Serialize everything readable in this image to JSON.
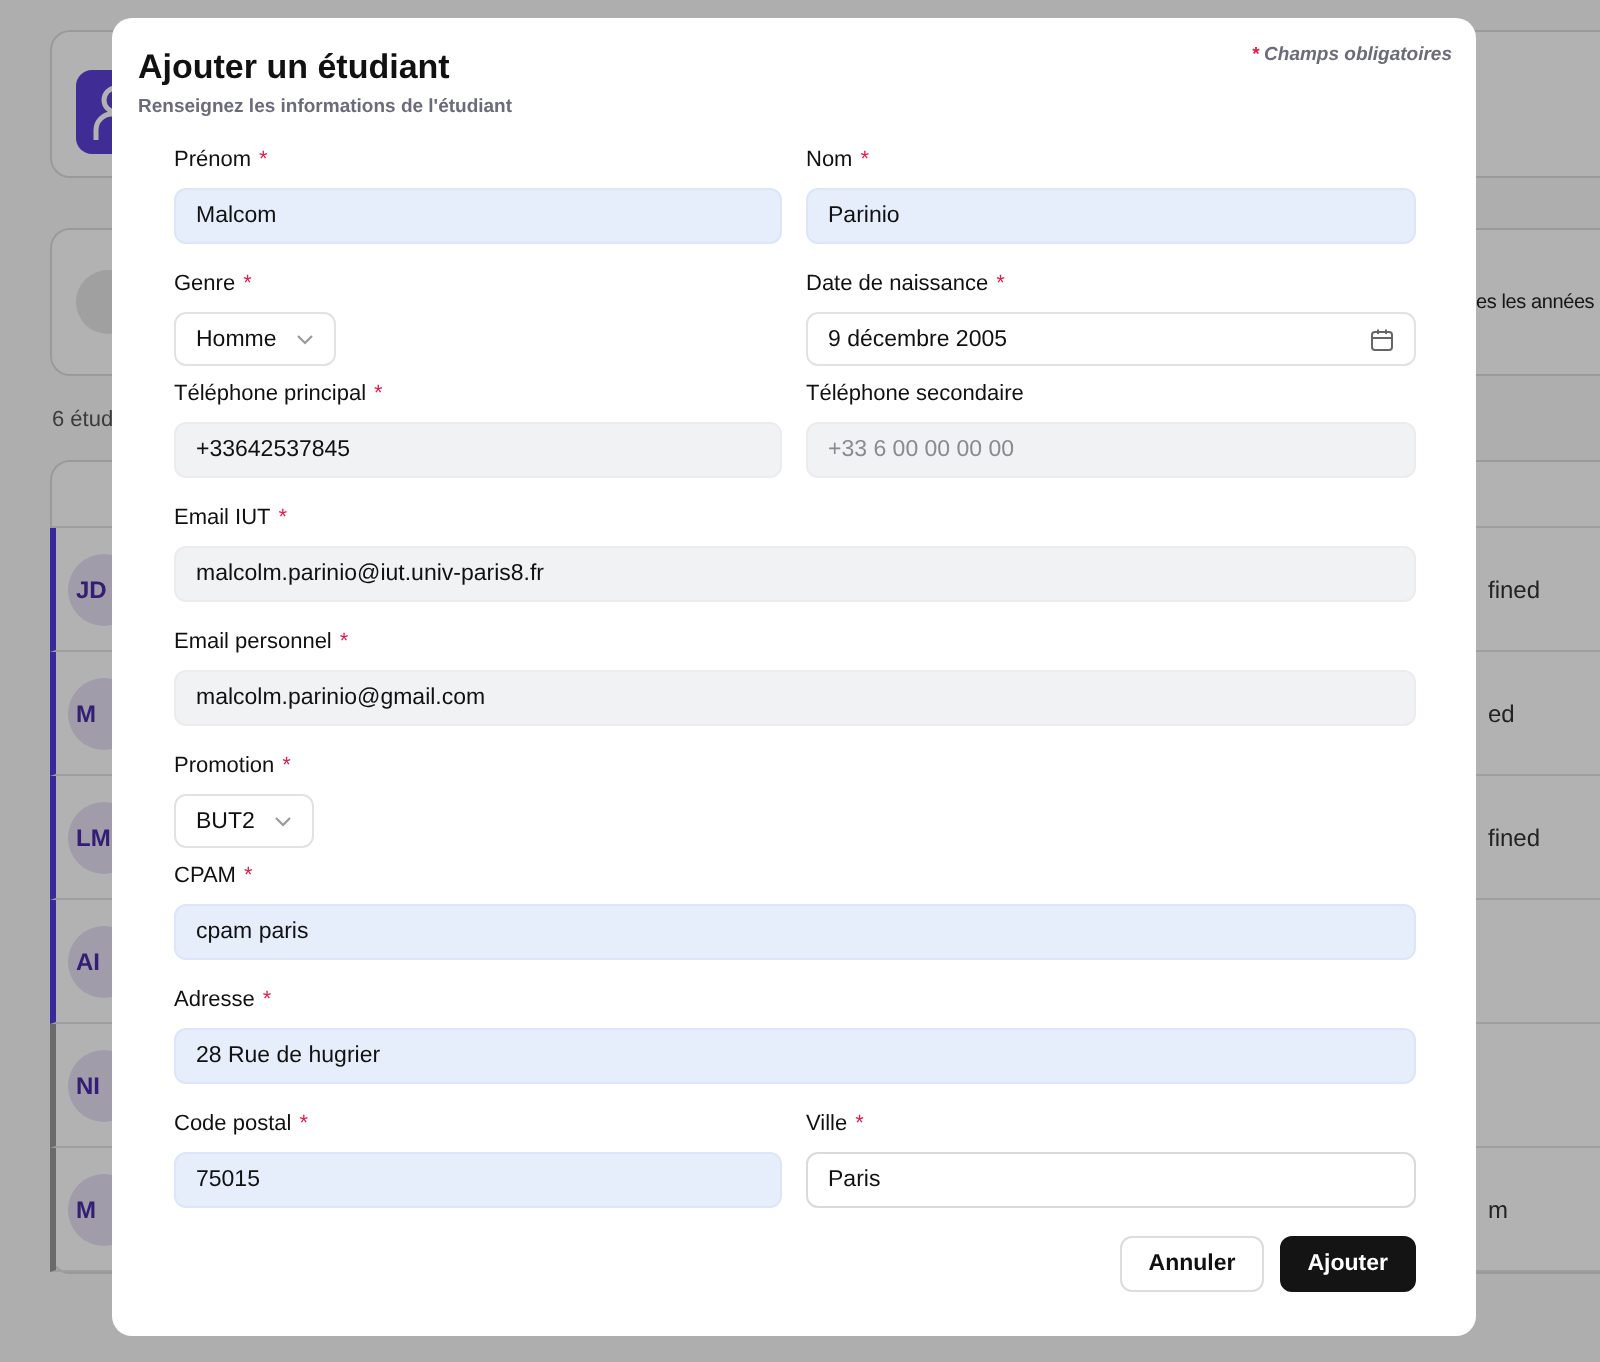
{
  "background": {
    "count_text": "6 étud",
    "year_filter": "es les années",
    "rows": [
      {
        "initials": "JD",
        "accent": true,
        "column_end": "fined"
      },
      {
        "initials": "M",
        "accent": true,
        "column_end": "ed"
      },
      {
        "initials": "LM",
        "accent": true,
        "column_end": "fined"
      },
      {
        "initials": "AI",
        "accent": true
      },
      {
        "initials": "NI",
        "accent": false
      },
      {
        "initials": "M",
        "accent": false,
        "column_end": "m"
      }
    ]
  },
  "dialog": {
    "title": "Ajouter un étudiant",
    "subtitle": "Renseignez les informations de l'étudiant",
    "required_note": "Champs obligatoires",
    "required_mark": "*",
    "rows": [
      [
        {
          "label": "Prénom",
          "required": true,
          "kind": "text",
          "value": "Malcom",
          "autofilled": true,
          "focused": false
        },
        {
          "label": "Nom",
          "required": true,
          "kind": "text",
          "value": "Parinio",
          "autofilled": true,
          "focused": false
        }
      ],
      [
        {
          "label": "Genre",
          "required": true,
          "kind": "select",
          "value": "Homme"
        },
        {
          "label": "Date de naissance",
          "required": true,
          "kind": "date",
          "value": "9 décembre 2005"
        }
      ],
      [
        {
          "label": "Téléphone principal",
          "required": true,
          "kind": "text",
          "value": "+33642537845",
          "autofilled": false,
          "focused": false
        },
        {
          "label": "Téléphone secondaire",
          "required": false,
          "kind": "text",
          "placeholder": "+33 6 00 00 00 00",
          "autofilled": false,
          "focused": false
        }
      ],
      [
        {
          "label": "Email IUT",
          "required": true,
          "kind": "text",
          "value": "malcolm.parinio@iut.univ-paris8.fr",
          "autofilled": false,
          "focused": false
        }
      ],
      [
        {
          "label": "Email personnel",
          "required": true,
          "kind": "text",
          "value": "malcolm.parinio@gmail.com",
          "autofilled": false,
          "focused": false
        }
      ],
      [
        {
          "label": "Promotion",
          "required": true,
          "kind": "select",
          "value": "BUT2"
        }
      ],
      [
        {
          "label": "CPAM",
          "required": true,
          "kind": "text",
          "value": "cpam paris",
          "autofilled": true,
          "focused": false
        }
      ],
      [
        {
          "label": "Adresse",
          "required": true,
          "kind": "text",
          "value": "28 Rue de hugrier",
          "autofilled": true,
          "focused": false
        }
      ],
      [
        {
          "label": "Code postal",
          "required": true,
          "kind": "text",
          "value": "75015",
          "autofilled": true,
          "focused": false
        },
        {
          "label": "Ville",
          "required": true,
          "kind": "text",
          "value": "Paris",
          "autofilled": false,
          "focused": true
        }
      ]
    ],
    "buttons": [
      {
        "label": "Annuler",
        "kind": "secondary"
      },
      {
        "label": "Ajouter",
        "kind": "primary"
      }
    ]
  }
}
